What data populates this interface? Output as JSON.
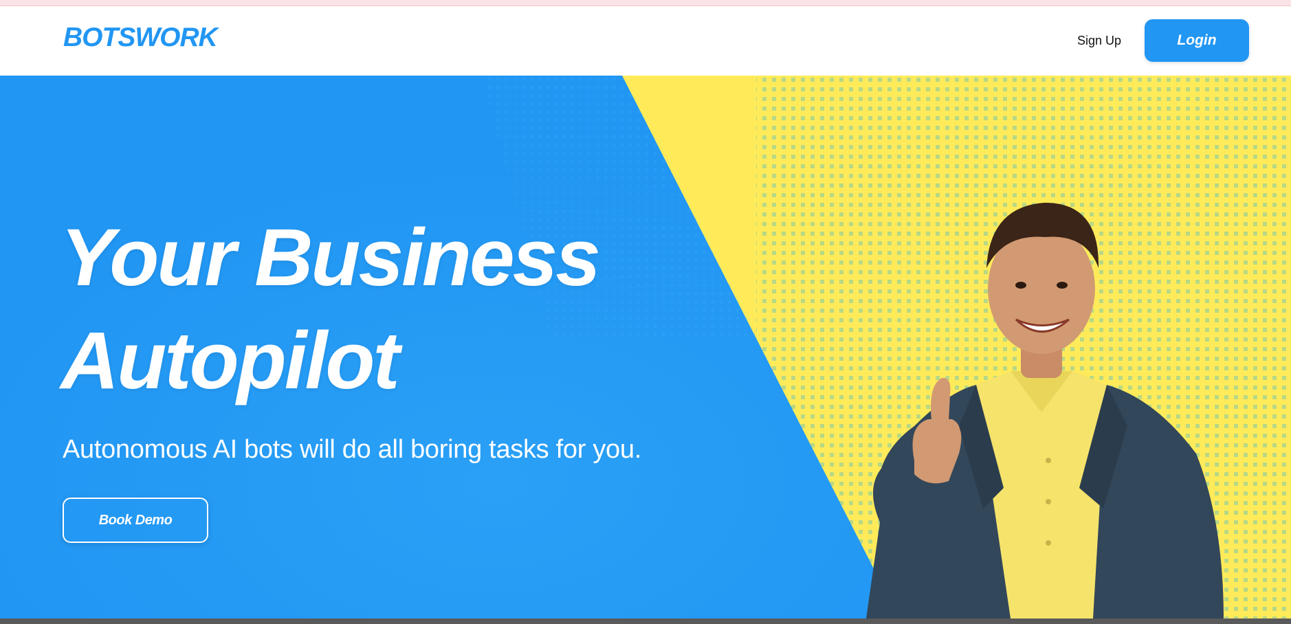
{
  "nav": {
    "brand": "BOTSWORK",
    "signup_label": "Sign Up",
    "login_label": "Login"
  },
  "hero": {
    "headline_line1": "Your Business",
    "headline_line2": "Autopilot",
    "subheadline": "Autonomous AI bots will do all boring tasks for you.",
    "cta_label": "Book Demo",
    "image_icon": "smiling-man-thumbs-up-icon"
  },
  "colors": {
    "brand_blue": "#2196f3",
    "accent_yellow": "#ffeb5a",
    "top_strip": "#fbe4e8"
  }
}
